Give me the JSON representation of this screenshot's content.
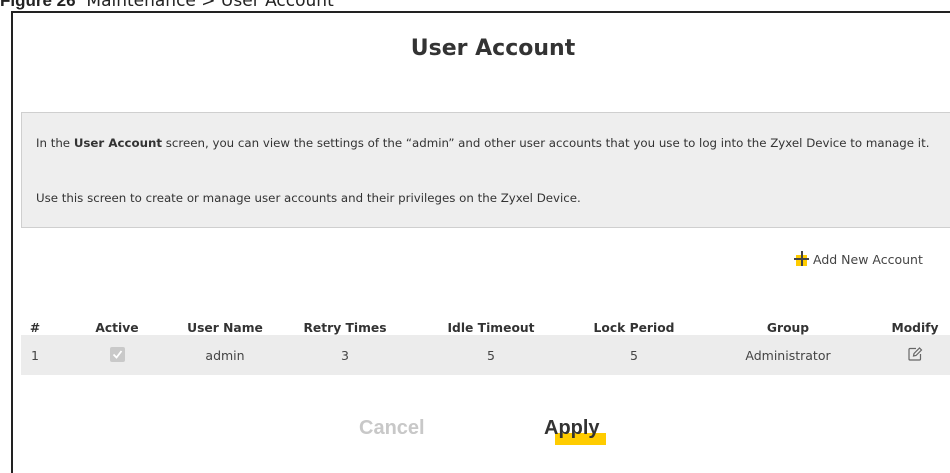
{
  "figure": {
    "label": "Figure 26",
    "text": "Maintenance > User Account"
  },
  "page": {
    "title": "User Account"
  },
  "info": {
    "p1_prefix": "In the ",
    "p1_bold": "User Account",
    "p1_suffix": " screen, you can view the settings of the “admin” and other user accounts that you use to log into the Zyxel Device to manage it.",
    "p2": "Use this screen to create or manage user accounts and their privileges on the Zyxel Device."
  },
  "toolbar": {
    "add_label": "Add New Account",
    "add_icon": "plus-icon"
  },
  "table": {
    "columns": [
      "#",
      "Active",
      "User Name",
      "Retry Times",
      "Idle Timeout",
      "Lock Period",
      "Group",
      "Modify"
    ],
    "rows": [
      {
        "index": "1",
        "active": true,
        "user_name": "admin",
        "retry_times": "3",
        "idle_timeout": "5",
        "lock_period": "5",
        "group": "Administrator",
        "modify_icon": "edit-icon"
      }
    ]
  },
  "actions": {
    "cancel_label": "Cancel",
    "apply_label": "Apply"
  },
  "colors": {
    "accent": "#ffcc00",
    "info_bg": "#eeeeee",
    "row_bg": "#ececec",
    "cancel_text": "#c8c8c8"
  }
}
